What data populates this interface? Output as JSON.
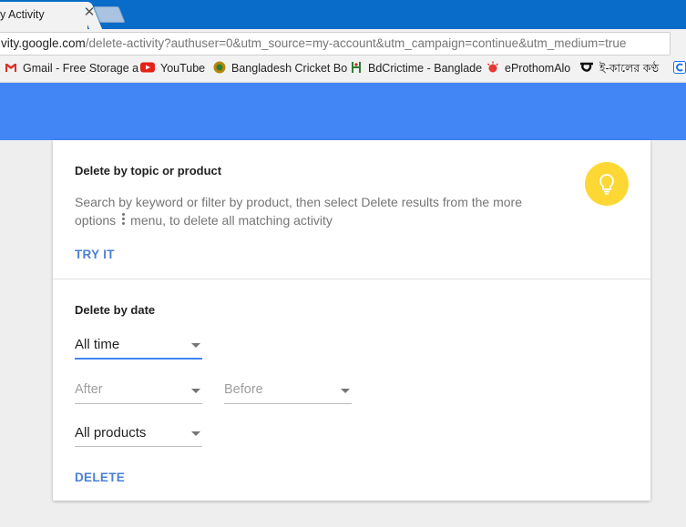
{
  "browser": {
    "tab_title": "y Activity",
    "tab_close": "✕",
    "url_host": "vity.google.com",
    "url_path": "/delete-activity?authuser=0&utm_source=my-account&utm_campaign=continue&utm_medium=true"
  },
  "bookmarks": [
    {
      "label": "Gmail - Free Storage a",
      "icon": "gmail-icon"
    },
    {
      "label": "YouTube",
      "icon": "youtube-icon"
    },
    {
      "label": "Bangladesh Cricket Bo",
      "icon": "cricket-board-icon"
    },
    {
      "label": "BdCrictime - Banglade",
      "icon": "bdcrictime-icon"
    },
    {
      "label": "eProthomAlo",
      "icon": "eprothomalo-icon"
    },
    {
      "label": "ই-কালের কণ্ঠ",
      "icon": "kalerkantho-icon"
    }
  ],
  "topic_section": {
    "title": "Delete by topic or product",
    "description_before": "Search by keyword or filter by product, then select Delete results from the more options",
    "description_after": "menu, to delete all matching activity",
    "action": "TRY IT"
  },
  "date_section": {
    "title": "Delete by date",
    "range_select": "All time",
    "after_placeholder": "After",
    "before_placeholder": "Before",
    "products_select": "All products",
    "action": "DELETE"
  },
  "colors": {
    "header": "#4285f4",
    "accent_link": "#4a7fd8",
    "bulb": "#fdd835",
    "tabstrip": "#0a6cc9"
  }
}
